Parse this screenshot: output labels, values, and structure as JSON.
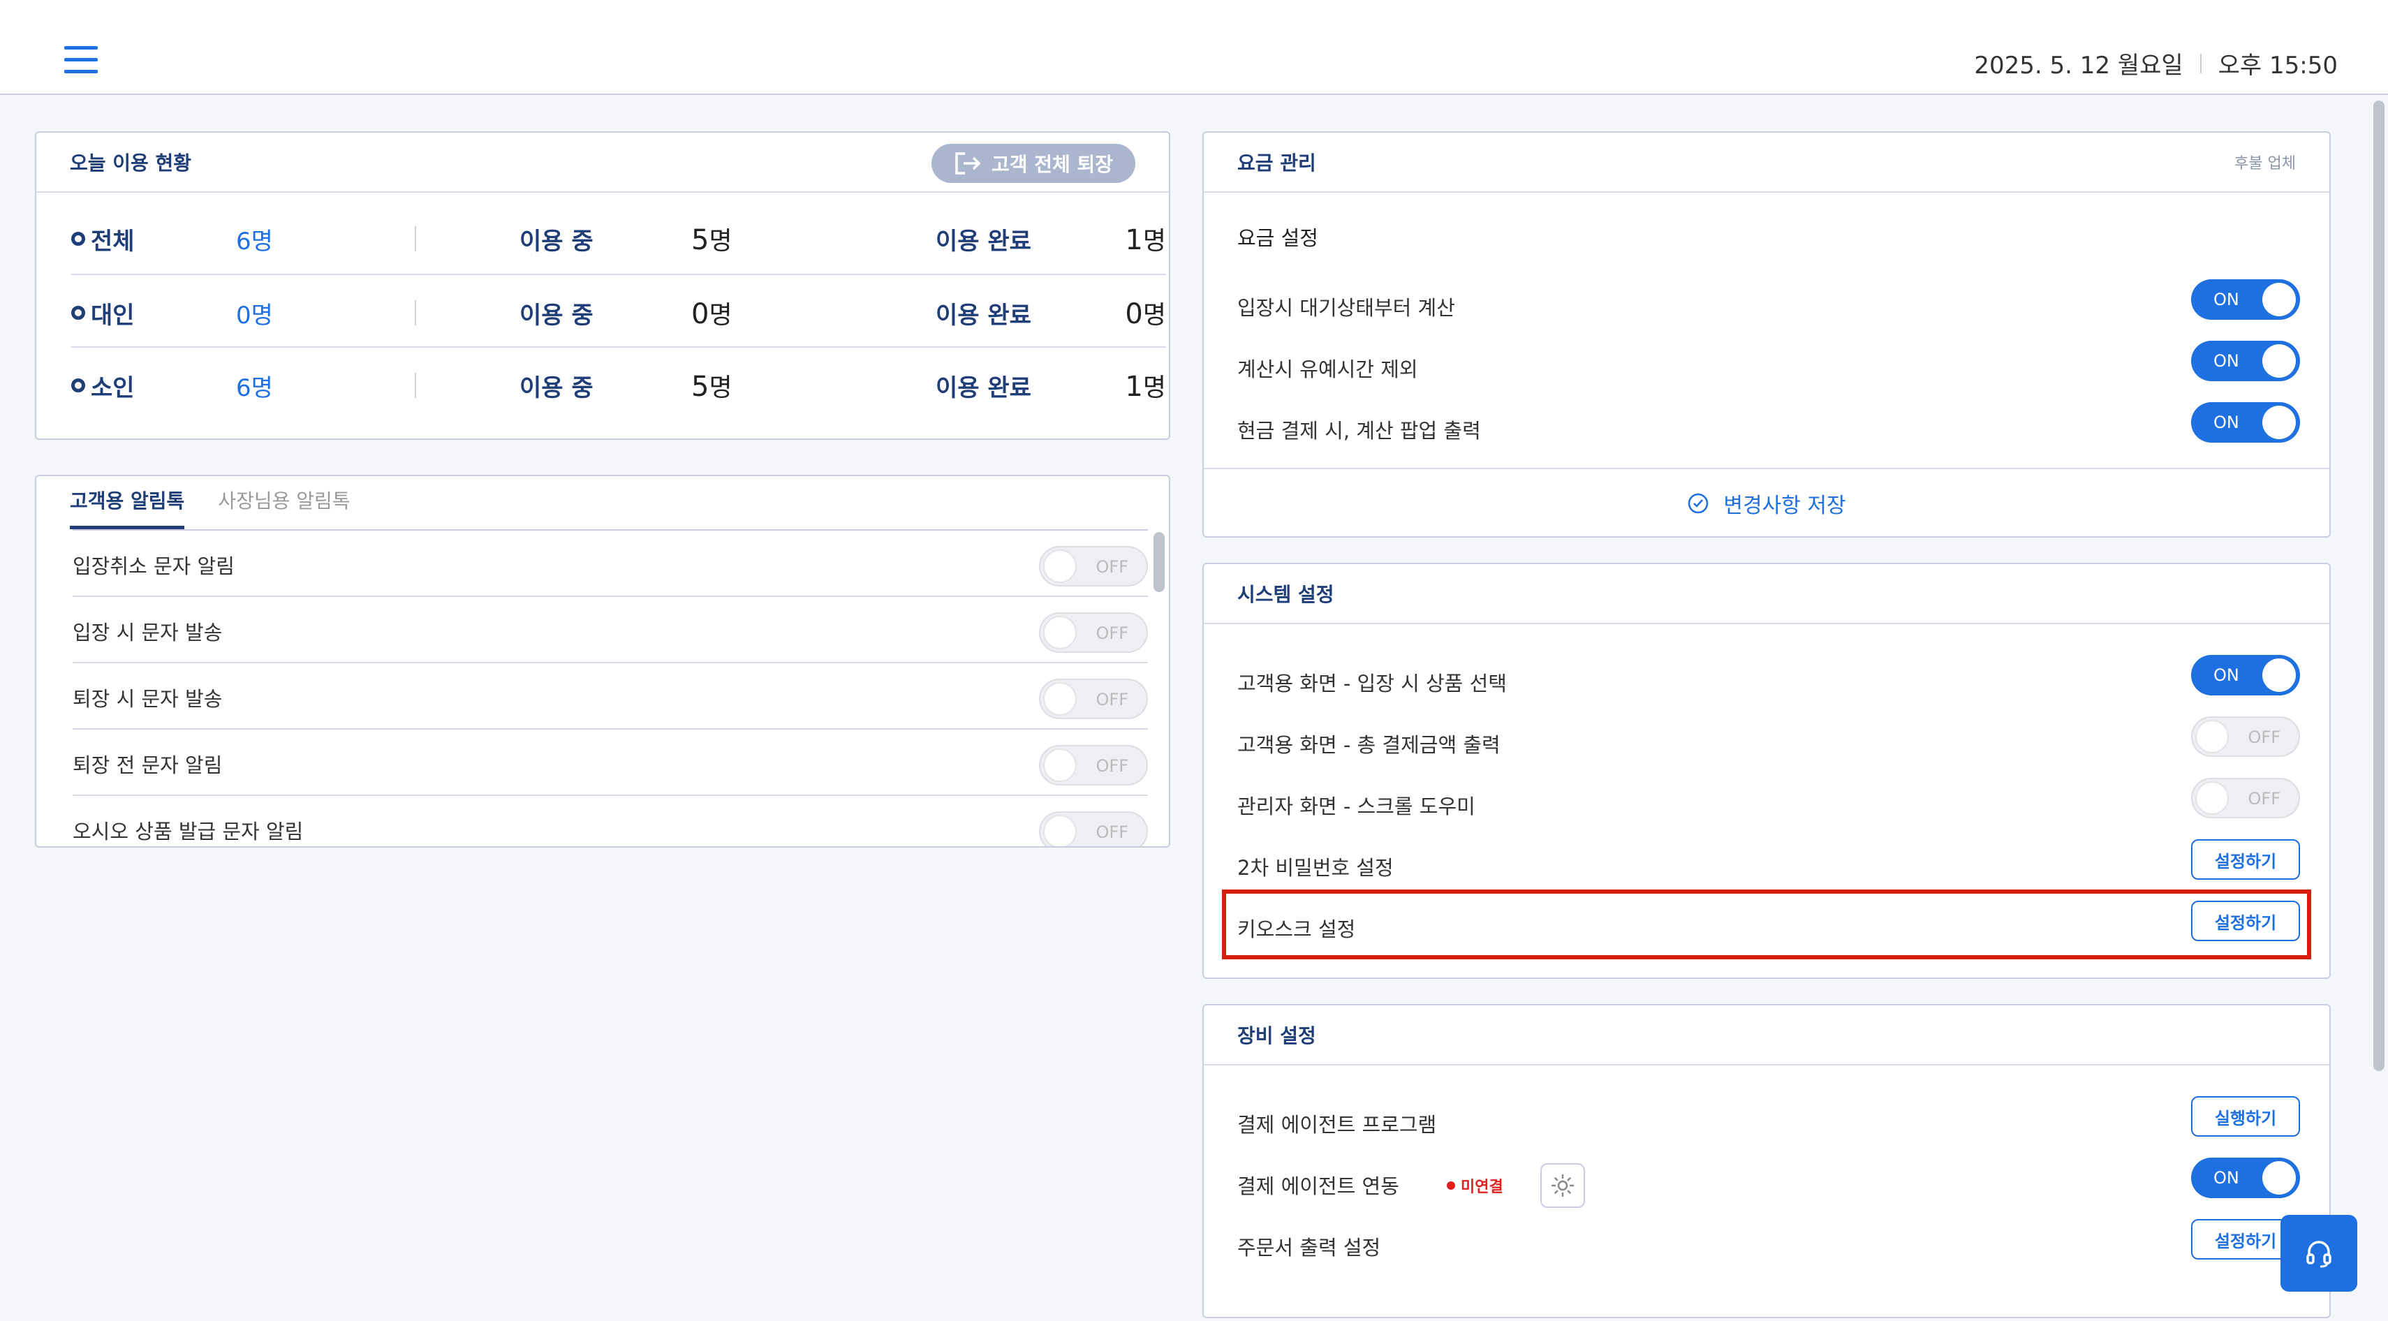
{
  "header": {
    "date": "2025. 5. 12 월요일",
    "time": "오후 15:50"
  },
  "usage": {
    "title": "오늘 이용 현황",
    "exit_all_label": "고객 전체 퇴장",
    "in_use_label": "이용 중",
    "done_label": "이용 완료",
    "unit": "명",
    "rows": [
      {
        "label": "전체",
        "total": "6명",
        "in_use": "5",
        "done": "1"
      },
      {
        "label": "대인",
        "total": "0명",
        "in_use": "0",
        "done": "0"
      },
      {
        "label": "소인",
        "total": "6명",
        "in_use": "5",
        "done": "1"
      }
    ]
  },
  "alim": {
    "tabs": [
      "고객용 알림톡",
      "사장님용 알림톡"
    ],
    "active_tab": 0,
    "off_label": "OFF",
    "items": [
      {
        "label": "입장취소 문자 알림",
        "state": "off"
      },
      {
        "label": "입장 시 문자 발송",
        "state": "off"
      },
      {
        "label": "퇴장 시 문자 발송",
        "state": "off"
      },
      {
        "label": "퇴장 전 문자 알림",
        "state": "off"
      },
      {
        "label": "오시오 상품 발급 문자 알림",
        "state": "off"
      }
    ]
  },
  "fee": {
    "title": "요금 관리",
    "subtitle": "후불 업체",
    "section_title": "요금 설정",
    "on_label": "ON",
    "items": [
      {
        "label": "입장시 대기상태부터 계산",
        "state": "on"
      },
      {
        "label": "계산시 유예시간 제외",
        "state": "on"
      },
      {
        "label": "현금 결제 시, 계산 팝업 출력",
        "state": "on"
      }
    ],
    "save_label": "변경사항 저장"
  },
  "system": {
    "title": "시스템 설정",
    "on_label": "ON",
    "off_label": "OFF",
    "items": [
      {
        "label": "고객용 화면 - 입장 시 상품 선택",
        "control": "toggle",
        "state": "on"
      },
      {
        "label": "고객용 화면 - 총 결제금액 출력",
        "control": "toggle",
        "state": "off"
      },
      {
        "label": "관리자 화면 - 스크롤 도우미",
        "control": "toggle",
        "state": "off"
      },
      {
        "label": "2차 비밀번호 설정",
        "control": "button",
        "button_label": "설정하기"
      },
      {
        "label": "키오스크 설정",
        "control": "button",
        "button_label": "설정하기"
      }
    ]
  },
  "equipment": {
    "title": "장비 설정",
    "on_label": "ON",
    "items": [
      {
        "label": "결제 에이전트 프로그램",
        "control": "button",
        "button_label": "실행하기"
      },
      {
        "label": "결제 에이전트 연동",
        "control": "toggle",
        "state": "on",
        "status": "미연결"
      },
      {
        "label": "주문서 출력 설정",
        "control": "button",
        "button_label": "설정하기"
      }
    ]
  },
  "colors": {
    "accent": "#1e6fe0",
    "title_navy": "#1f3e78",
    "highlight": "#d6200c"
  }
}
